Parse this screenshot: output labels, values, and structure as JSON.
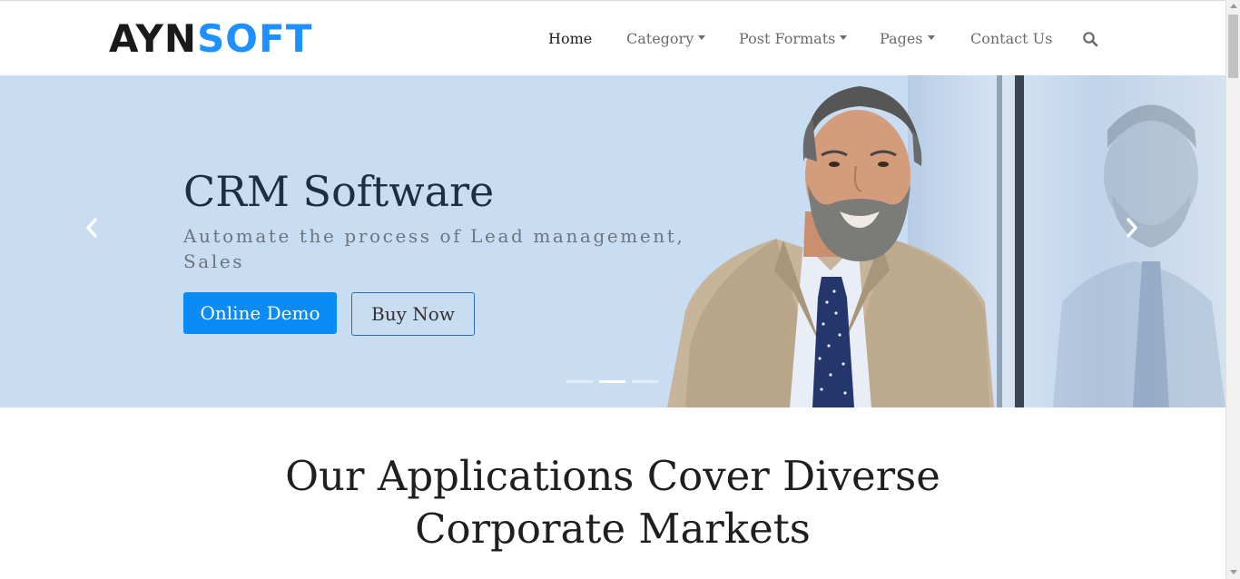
{
  "brand": {
    "part1": "AYN",
    "part2": "SOFT",
    "color_primary": "#1a1a1a",
    "color_accent": "#1e90ff"
  },
  "nav": {
    "items": [
      {
        "label": "Home",
        "active": true,
        "dropdown": false
      },
      {
        "label": "Category",
        "active": false,
        "dropdown": true
      },
      {
        "label": "Post Formats",
        "active": false,
        "dropdown": true
      },
      {
        "label": "Pages",
        "active": false,
        "dropdown": true
      },
      {
        "label": "Contact Us",
        "active": false,
        "dropdown": false
      }
    ],
    "search_icon": "search-icon"
  },
  "hero": {
    "title": "CRM Software",
    "subtitle": "Automate the process of Lead management, Sales",
    "primary_button": "Online Demo",
    "secondary_button": "Buy Now",
    "slides_count": 3,
    "active_slide": 2,
    "prev_icon": "chevron-left-icon",
    "next_icon": "chevron-right-icon",
    "primary_color": "#0a8bf5"
  },
  "section": {
    "title_line1": "Our Applications Cover Diverse",
    "title_line2": "Corporate Markets"
  }
}
